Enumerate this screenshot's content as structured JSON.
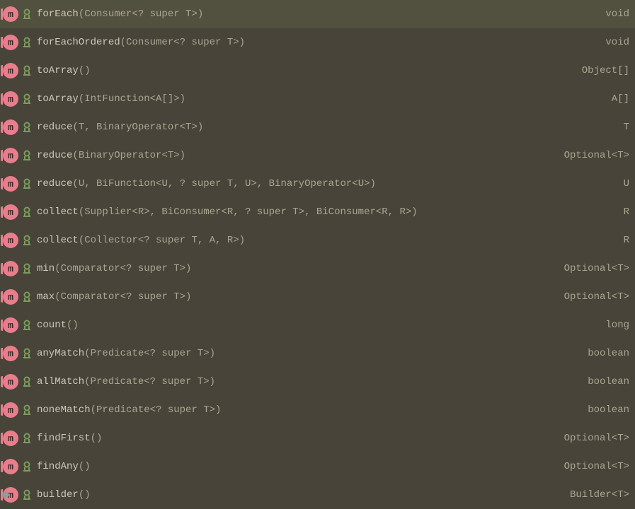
{
  "methods": [
    {
      "name": "forEach",
      "params": "(Consumer<? super T>)",
      "returnType": "void",
      "isAbstract": true
    },
    {
      "name": "forEachOrdered",
      "params": "(Consumer<? super T>)",
      "returnType": "void",
      "isAbstract": true
    },
    {
      "name": "toArray",
      "params": "()",
      "returnType": "Object[]",
      "isAbstract": true
    },
    {
      "name": "toArray",
      "params": "(IntFunction<A[]>)",
      "returnType": "A[]",
      "isAbstract": true
    },
    {
      "name": "reduce",
      "params": "(T, BinaryOperator<T>)",
      "returnType": "T",
      "isAbstract": true
    },
    {
      "name": "reduce",
      "params": "(BinaryOperator<T>)",
      "returnType": "Optional<T>",
      "isAbstract": true
    },
    {
      "name": "reduce",
      "params": "(U, BiFunction<U, ? super T, U>, BinaryOperator<U>)",
      "returnType": "U",
      "isAbstract": true
    },
    {
      "name": "collect",
      "params": "(Supplier<R>, BiConsumer<R, ? super T>, BiConsumer<R, R>)",
      "returnType": "R",
      "isAbstract": true
    },
    {
      "name": "collect",
      "params": "(Collector<? super T, A, R>)",
      "returnType": "R",
      "isAbstract": true
    },
    {
      "name": "min",
      "params": "(Comparator<? super T>)",
      "returnType": "Optional<T>",
      "isAbstract": true
    },
    {
      "name": "max",
      "params": "(Comparator<? super T>)",
      "returnType": "Optional<T>",
      "isAbstract": true
    },
    {
      "name": "count",
      "params": "()",
      "returnType": "long",
      "isAbstract": true
    },
    {
      "name": "anyMatch",
      "params": "(Predicate<? super T>)",
      "returnType": "boolean",
      "isAbstract": true
    },
    {
      "name": "allMatch",
      "params": "(Predicate<? super T>)",
      "returnType": "boolean",
      "isAbstract": true
    },
    {
      "name": "noneMatch",
      "params": "(Predicate<? super T>)",
      "returnType": "boolean",
      "isAbstract": true
    },
    {
      "name": "findFirst",
      "params": "()",
      "returnType": "Optional<T>",
      "isAbstract": true
    },
    {
      "name": "findAny",
      "params": "()",
      "returnType": "Optional<T>",
      "isAbstract": true
    },
    {
      "name": "builder",
      "params": "()",
      "returnType": "Builder<T>",
      "isAbstract": true,
      "hasIndicator": true
    }
  ],
  "iconLetter": "m"
}
